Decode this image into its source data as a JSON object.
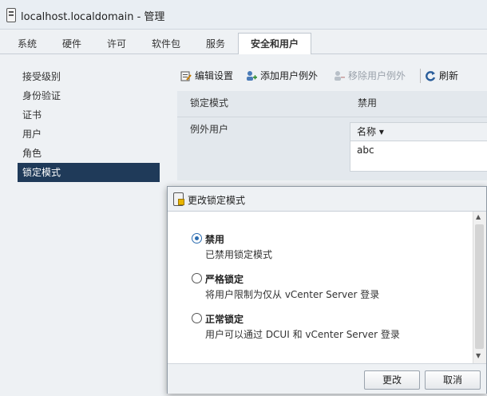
{
  "window": {
    "title": "localhost.localdomain - 管理"
  },
  "tabs": [
    {
      "label": "系统"
    },
    {
      "label": "硬件"
    },
    {
      "label": "许可"
    },
    {
      "label": "软件包"
    },
    {
      "label": "服务"
    },
    {
      "label": "安全和用户",
      "active": true
    }
  ],
  "sidebar": {
    "items": [
      {
        "label": "接受级别"
      },
      {
        "label": "身份验证"
      },
      {
        "label": "证书"
      },
      {
        "label": "用户"
      },
      {
        "label": "角色"
      },
      {
        "label": "锁定模式",
        "active": true
      }
    ]
  },
  "toolbar": {
    "edit_settings": "编辑设置",
    "add_user_exception": "添加用户例外",
    "remove_user_exception": "移除用户例外",
    "refresh": "刷新"
  },
  "properties": {
    "lockdown_mode_label": "锁定模式",
    "lockdown_mode_value": "禁用",
    "exception_users_label": "例外用户",
    "list_header": "名称 ▾",
    "list_rows": [
      "abc"
    ]
  },
  "dialog": {
    "title": "更改锁定模式",
    "options": [
      {
        "title": "禁用",
        "description": "已禁用锁定模式",
        "checked": true
      },
      {
        "title": "严格锁定",
        "description": "将用户限制为仅从 vCenter Server 登录",
        "checked": false
      },
      {
        "title": "正常锁定",
        "description": "用户可以通过 DCUI 和 vCenter Server 登录",
        "checked": false
      }
    ],
    "ok_label": "更改",
    "cancel_label": "取消"
  },
  "colors": {
    "selected_nav_bg": "#1f3a59",
    "radio_accent": "#2b6cb0"
  },
  "icons": [
    "host-icon",
    "edit-settings-icon",
    "add-user-icon",
    "remove-user-icon",
    "refresh-icon",
    "lock-icon"
  ]
}
